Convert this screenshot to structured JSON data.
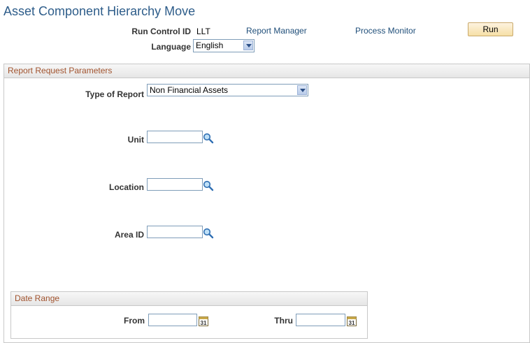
{
  "page": {
    "title": "Asset Component Hierarchy Move"
  },
  "header": {
    "run_control_label": "Run Control ID",
    "run_control_value": "LLT",
    "report_manager_link": "Report Manager",
    "process_monitor_link": "Process Monitor",
    "run_button": "Run",
    "language_label": "Language",
    "language_value": "English"
  },
  "params": {
    "section_title": "Report Request Parameters",
    "type_label": "Type of Report",
    "type_value": "Non Financial Assets",
    "unit_label": "Unit",
    "unit_value": "",
    "location_label": "Location",
    "location_value": "",
    "area_label": "Area ID",
    "area_value": ""
  },
  "date_range": {
    "title": "Date Range",
    "from_label": "From",
    "from_value": "",
    "thru_label": "Thru",
    "thru_value": ""
  },
  "icons": {
    "lookup": "magnifier-lookup-icon",
    "calendar": "calendar-icon"
  },
  "colors": {
    "title": "#2e5d8a",
    "section_title": "#a0522d",
    "link": "#1f4e79",
    "button": "#f6dfa6"
  }
}
